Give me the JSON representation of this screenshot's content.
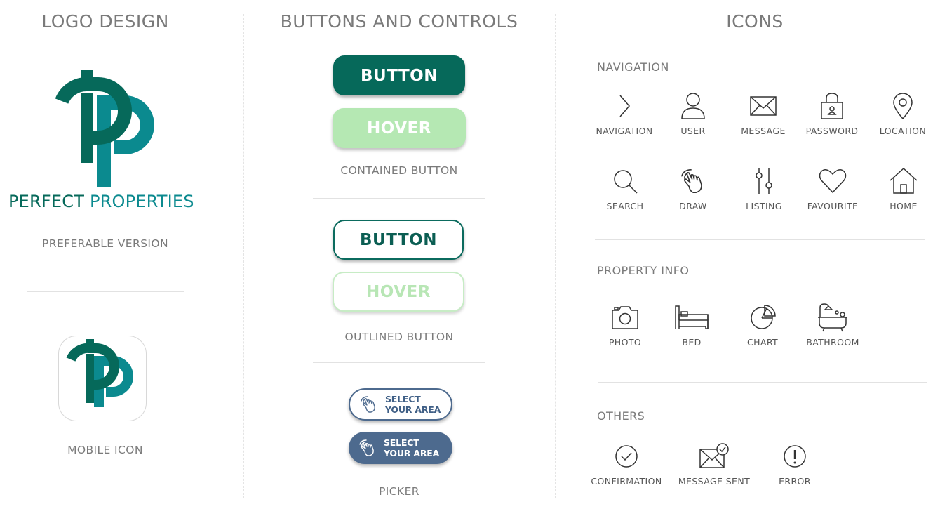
{
  "colors": {
    "brand_dark": "#06695a",
    "brand_teal": "#0b8a8f",
    "hover_green": "#b5e8b3",
    "picker_blue": "#4d6a8e",
    "text_gray": "#7a7a7a"
  },
  "logo_section": {
    "title": "LOGO DESIGN",
    "brand_word1": "PERFECT",
    "brand_word2": "PROPERTIES",
    "preferable_caption": "PREFERABLE VERSION",
    "mobile_caption": "MOBILE ICON"
  },
  "buttons_section": {
    "title": "BUTTONS AND CONTROLS",
    "contained": {
      "label": "BUTTON",
      "hover_label": "HOVER",
      "caption": "CONTAINED BUTTON"
    },
    "outlined": {
      "label": "BUTTON",
      "hover_label": "HOVER",
      "caption": "OUTLINED BUTTON"
    },
    "picker": {
      "line1": "SELECT",
      "line2": "YOUR AREA",
      "caption": "PICKER"
    }
  },
  "icons_section": {
    "title": "ICONS",
    "navigation": {
      "title": "NAVIGATION",
      "items": [
        {
          "label": "NAVIGATION",
          "icon": "chevron-right-icon"
        },
        {
          "label": "USER",
          "icon": "user-icon"
        },
        {
          "label": "MESSAGE",
          "icon": "envelope-icon"
        },
        {
          "label": "PASSWORD",
          "icon": "lock-icon"
        },
        {
          "label": "LOCATION",
          "icon": "map-pin-icon"
        },
        {
          "label": "SEARCH",
          "icon": "search-icon"
        },
        {
          "label": "DRAW",
          "icon": "hand-pointer-icon"
        },
        {
          "label": "LISTING",
          "icon": "sliders-icon"
        },
        {
          "label": "FAVOURITE",
          "icon": "heart-icon"
        },
        {
          "label": "HOME",
          "icon": "home-icon"
        }
      ]
    },
    "property_info": {
      "title": "PROPERTY INFO",
      "items": [
        {
          "label": "PHOTO",
          "icon": "camera-icon"
        },
        {
          "label": "BED",
          "icon": "bed-icon"
        },
        {
          "label": "CHART",
          "icon": "pie-chart-icon"
        },
        {
          "label": "BATHROOM",
          "icon": "bathtub-icon"
        }
      ]
    },
    "others": {
      "title": "OTHERS",
      "items": [
        {
          "label": "CONFIRMATION",
          "icon": "check-circle-icon"
        },
        {
          "label": "MESSAGE SENT",
          "icon": "message-sent-icon"
        },
        {
          "label": "ERROR",
          "icon": "error-icon"
        }
      ]
    }
  }
}
